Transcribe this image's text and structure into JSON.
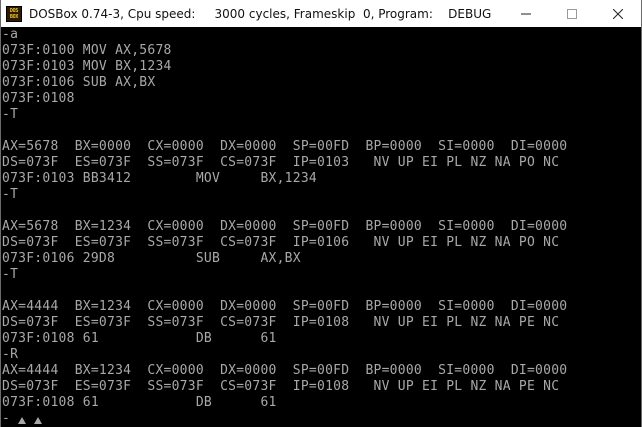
{
  "window": {
    "title": "DOSBox 0.74-3, Cpu speed:     3000 cycles, Frameskip  0, Program:    DEBUG",
    "icon_text_top": "DOS",
    "icon_text_bottom": "BOX",
    "icons": {
      "minimize": "minimize-icon",
      "maximize": "maximize-icon",
      "close": "close-icon"
    }
  },
  "console": {
    "lines": [
      "-a",
      "073F:0100 MOV AX,5678",
      "073F:0103 MOV BX,1234",
      "073F:0106 SUB AX,BX",
      "073F:0108",
      "-T",
      "",
      "AX=5678  BX=0000  CX=0000  DX=0000  SP=00FD  BP=0000  SI=0000  DI=0000",
      "DS=073F  ES=073F  SS=073F  CS=073F  IP=0103   NV UP EI PL NZ NA PO NC",
      "073F:0103 BB3412        MOV     BX,1234",
      "-T",
      "",
      "AX=5678  BX=1234  CX=0000  DX=0000  SP=00FD  BP=0000  SI=0000  DI=0000",
      "DS=073F  ES=073F  SS=073F  CS=073F  IP=0106   NV UP EI PL NZ NA PO NC",
      "073F:0106 29D8          SUB     AX,BX",
      "-T",
      "",
      "AX=4444  BX=1234  CX=0000  DX=0000  SP=00FD  BP=0000  SI=0000  DI=0000",
      "DS=073F  ES=073F  SS=073F  CS=073F  IP=0108   NV UP EI PL NZ NA PE NC",
      "073F:0108 61            DB      61",
      "-R",
      "AX=4444  BX=1234  CX=0000  DX=0000  SP=00FD  BP=0000  SI=0000  DI=0000",
      "DS=073F  ES=073F  SS=073F  CS=073F  IP=0108   NV UP EI PL NZ NA PE NC",
      "073F:0108 61            DB      61"
    ],
    "prompt": "-",
    "colors": {
      "text": "#a8a8a8",
      "background": "#000000"
    }
  }
}
